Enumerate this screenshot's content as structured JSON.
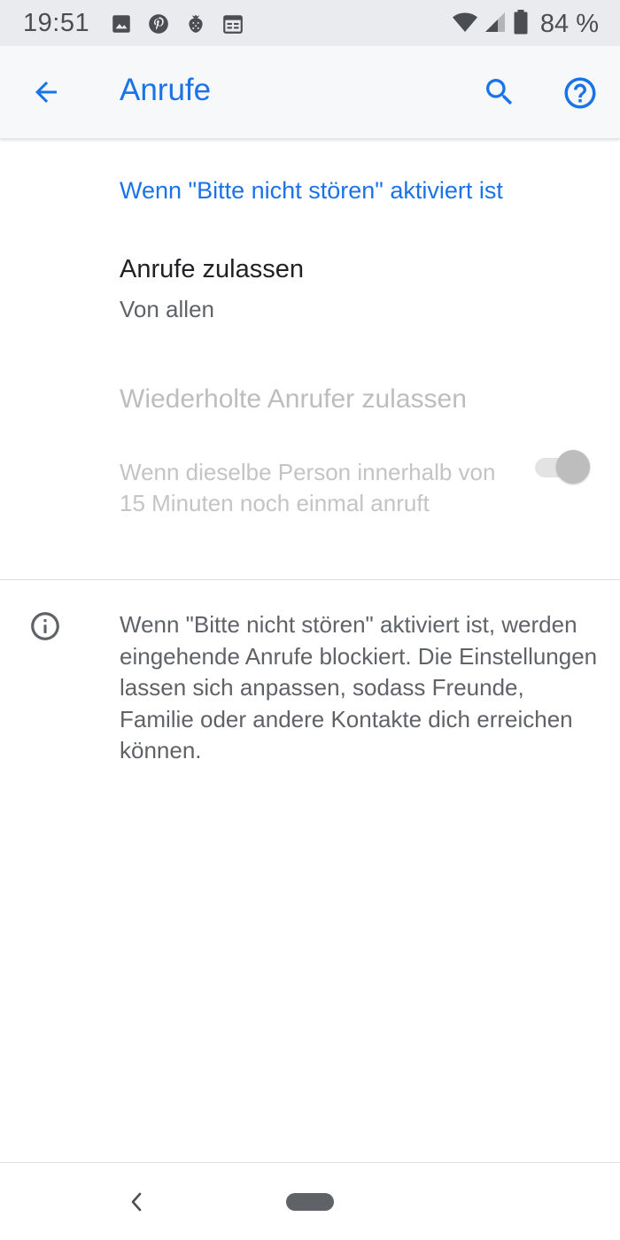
{
  "status_bar": {
    "time": "19:51",
    "battery_percent": "84 %",
    "notification_icons": [
      "image-icon",
      "pinterest-icon",
      "strawberry-icon",
      "calendar-icon"
    ],
    "system_icons": [
      "wifi-icon",
      "cell-signal-icon",
      "battery-icon"
    ]
  },
  "app_bar": {
    "title": "Anrufe",
    "back_icon": "arrow-back-icon",
    "actions": [
      "search-icon",
      "help-icon"
    ]
  },
  "content": {
    "section_header": "Wenn \"Bitte nicht stören\" aktiviert ist",
    "allow_calls": {
      "title": "Anrufe zulassen",
      "summary": "Von allen"
    },
    "repeat_callers": {
      "title": "Wiederholte Anrufer zulassen",
      "summary": "Wenn dieselbe Person innerhalb von 15 Minuten noch einmal anruft",
      "enabled": false,
      "checked": true
    },
    "info": {
      "icon": "info-icon",
      "text": "Wenn \"Bitte nicht stören\" aktiviert ist, werden eingehende Anrufe blockiert. Die Einstellungen lassen sich anpassen, sodass Freunde, Familie oder andere Kontakte dich erreichen können."
    }
  },
  "nav_bar": {
    "buttons": [
      "nav-back-icon",
      "home-pill"
    ]
  },
  "colors": {
    "accent": "#1a73e8",
    "primary_text": "#202124",
    "secondary_text": "#5f6368",
    "disabled_text": "#bdbdbd",
    "status_bar_bg": "#eaebee",
    "app_bar_bg": "#f7f8fa"
  }
}
